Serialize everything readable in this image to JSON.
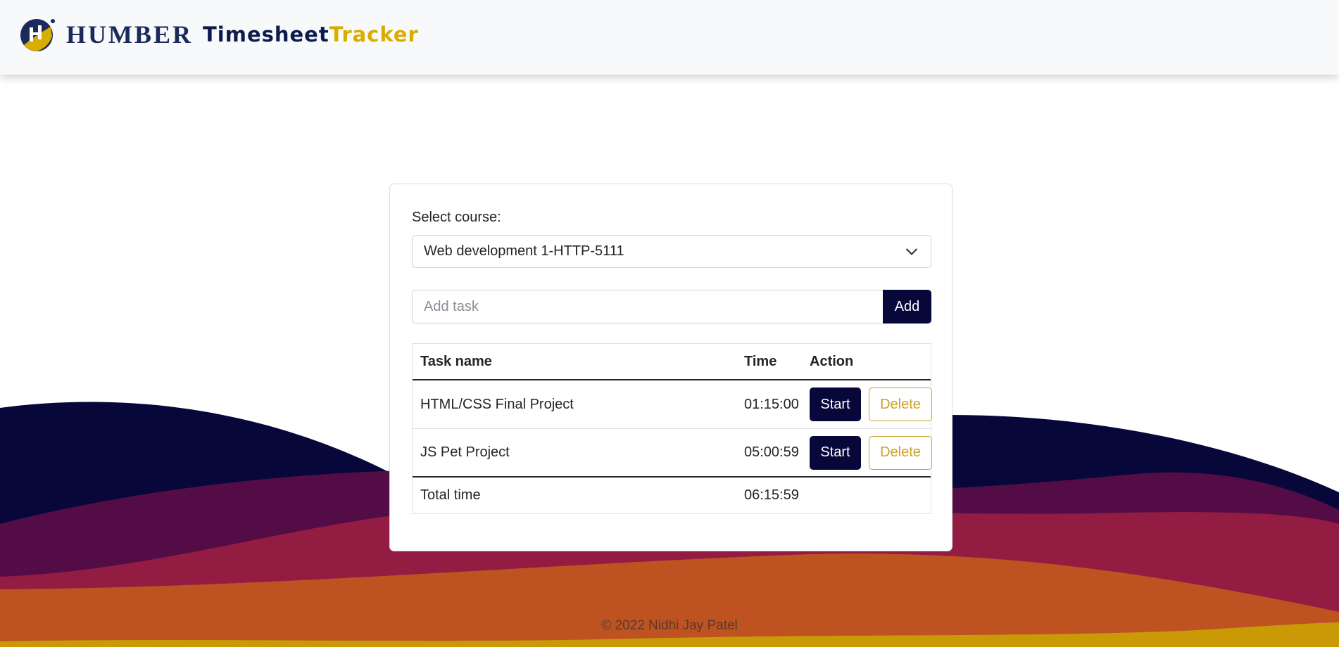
{
  "header": {
    "logo_icon": "humber-h-icon",
    "brand_name": "HUMBER",
    "app_name_part1": "Timesheet",
    "app_name_part2": "Tracker",
    "colors": {
      "navy": "#0b1b4d",
      "gold": "#d8ad00"
    }
  },
  "form": {
    "course_label": "Select course:",
    "selected_course": "Web development 1-HTTP-5111",
    "task_placeholder": "Add task",
    "task_value": "",
    "add_label": "Add"
  },
  "table": {
    "headers": {
      "name": "Task name",
      "time": "Time",
      "action": "Action"
    },
    "rows": [
      {
        "name": "HTML/CSS Final Project",
        "time": "01:15:00",
        "start_label": "Start",
        "delete_label": "Delete"
      },
      {
        "name": "JS Pet Project",
        "time": "05:00:59",
        "start_label": "Start",
        "delete_label": "Delete"
      }
    ],
    "total": {
      "label": "Total time",
      "time": "06:15:59"
    }
  },
  "footer": {
    "copyright": "© 2022 Nidhi Jay Patel"
  },
  "theme": {
    "primary": "#07073a",
    "accent": "#c9a227",
    "wave_colors": [
      "#07073a",
      "#530c45",
      "#931c42",
      "#be5221",
      "#c99a06"
    ]
  }
}
